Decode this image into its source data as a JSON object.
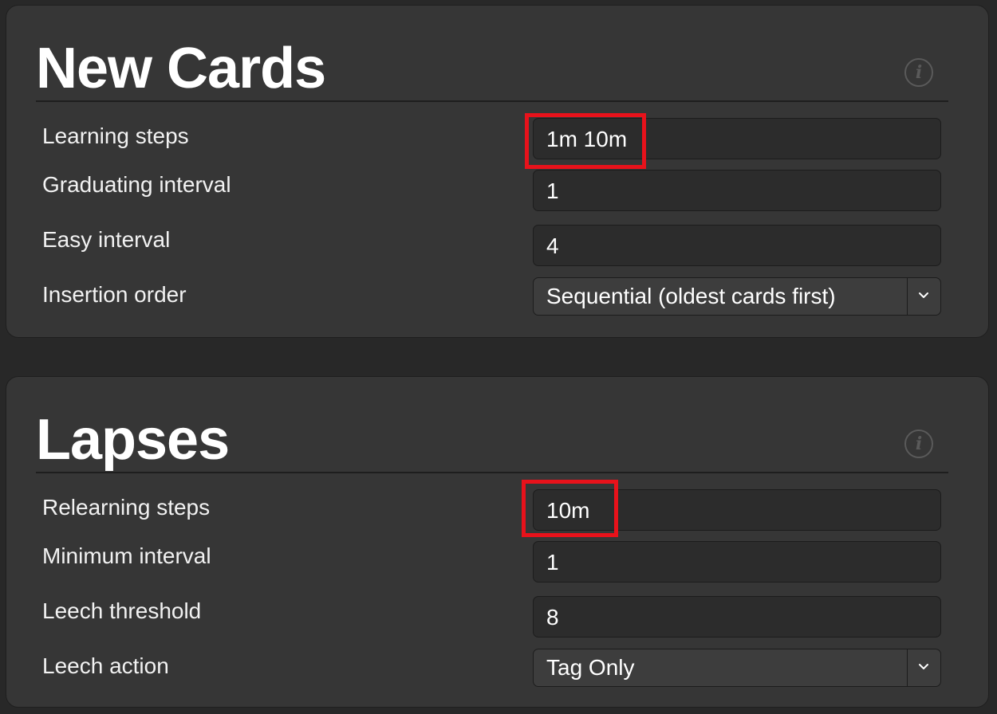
{
  "new_cards": {
    "title": "New Cards",
    "info_icon": "info-icon",
    "learning_steps": {
      "label": "Learning steps",
      "value": "1m 10m"
    },
    "graduating_interval": {
      "label": "Graduating interval",
      "value": "1"
    },
    "easy_interval": {
      "label": "Easy interval",
      "value": "4"
    },
    "insertion_order": {
      "label": "Insertion order",
      "value": "Sequential (oldest cards first)"
    }
  },
  "lapses": {
    "title": "Lapses",
    "info_icon": "info-icon",
    "relearning_steps": {
      "label": "Relearning steps",
      "value": "10m"
    },
    "minimum_interval": {
      "label": "Minimum interval",
      "value": "1"
    },
    "leech_threshold": {
      "label": "Leech threshold",
      "value": "8"
    },
    "leech_action": {
      "label": "Leech action",
      "value": "Tag Only"
    }
  },
  "colors": {
    "background": "#282828",
    "card": "#363636",
    "field": "#2c2c2c",
    "highlight": "#e8121b"
  }
}
